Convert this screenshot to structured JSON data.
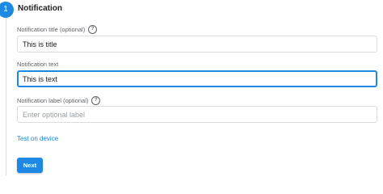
{
  "stepper": {
    "step_number": "1",
    "title": "Notification"
  },
  "form": {
    "title_field": {
      "label": "Notification title (optional)",
      "help_icon": "?",
      "value": "This is title"
    },
    "text_field": {
      "label": "Notification text",
      "value": "This is text"
    },
    "label_field": {
      "label": "Notification label (optional)",
      "help_icon": "?",
      "value": "",
      "placeholder": "Enter optional label"
    }
  },
  "actions": {
    "test_link": "Test on device",
    "next_button": "Next"
  },
  "colors": {
    "accent": "#1e88e5",
    "border": "#dadce0",
    "label": "#5f6368"
  }
}
